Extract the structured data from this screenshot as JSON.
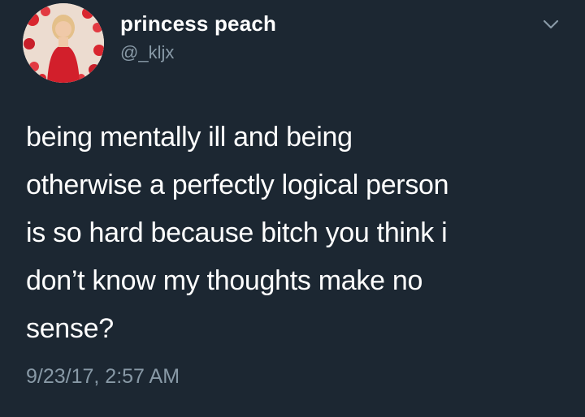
{
  "user": {
    "display_name": "princess peach",
    "handle": "@_kljx"
  },
  "tweet": {
    "lines": [
      "being mentally ill and being",
      "otherwise a perfectly logical person",
      "is so hard because bitch you think i",
      "don’t know my thoughts make no",
      "sense?"
    ],
    "timestamp": "9/23/17, 2:57 AM"
  },
  "icons": {
    "avatar": "profile-photo",
    "menu": "chevron-down-icon"
  },
  "colors": {
    "background": "#1c2732",
    "text": "#ffffff",
    "secondary_text": "#8899a6"
  }
}
